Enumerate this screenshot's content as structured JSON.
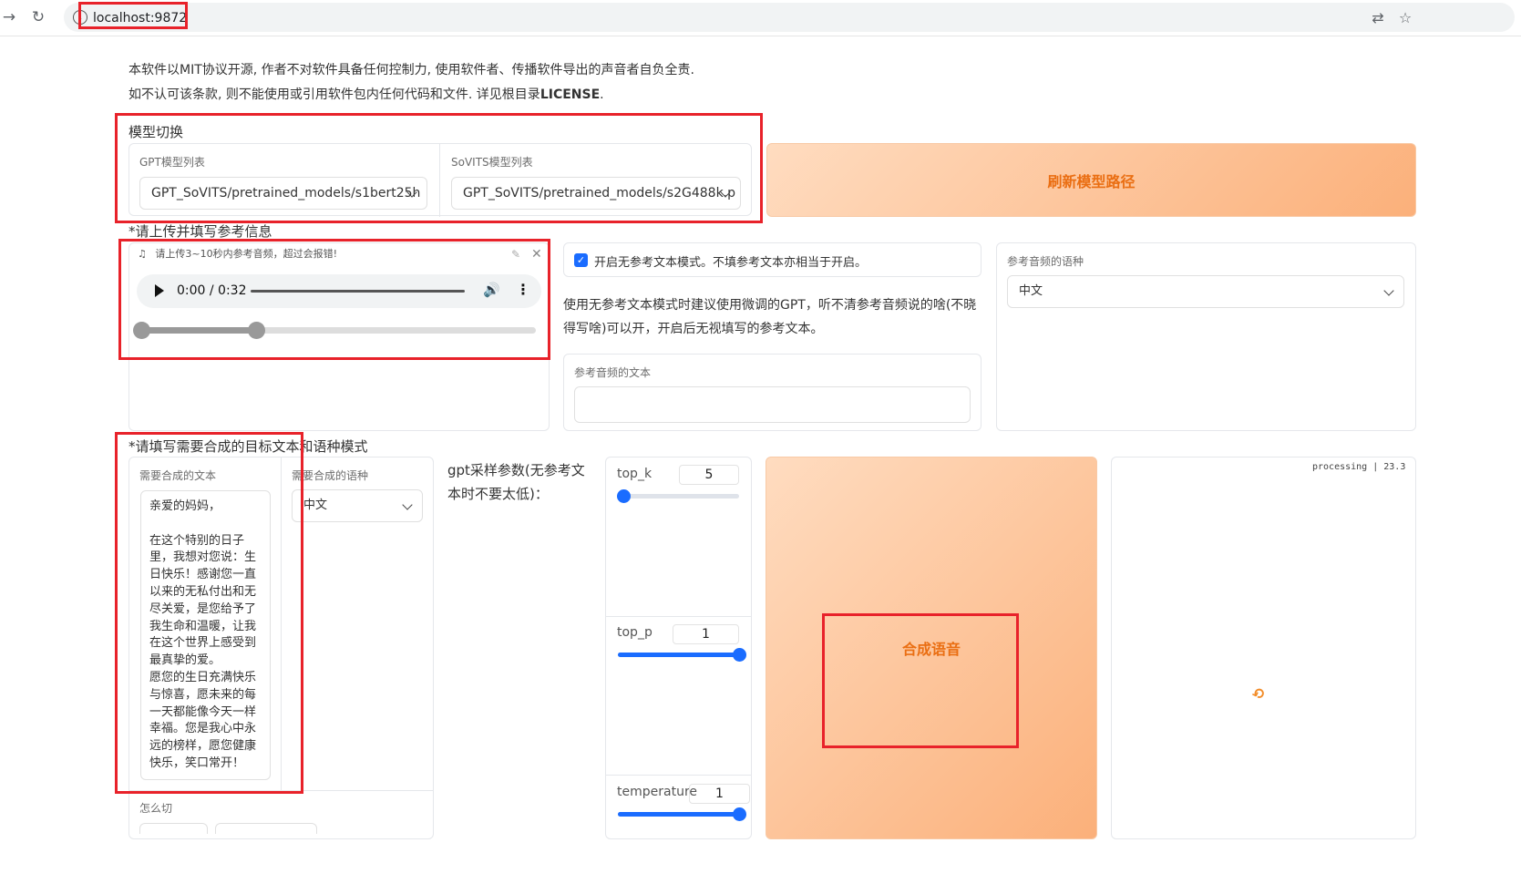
{
  "browser": {
    "url": "localhost:9872",
    "back_icon": "arrow-right-icon",
    "reload_icon": "reload-icon",
    "translate_icon": "translate-icon",
    "star_icon": "star-icon"
  },
  "notice": {
    "line1": "本软件以MIT协议开源, 作者不对软件具备任何控制力, 使用软件者、传播软件导出的声音者自负全责.",
    "line2_prefix": "如不认可该条款, 则不能使用或引用软件包内任何代码和文件. 详见根目录",
    "line2_bold": "LICENSE",
    "line2_suffix": "."
  },
  "model_switch": {
    "title": "模型切换",
    "gpt_label": "GPT模型列表",
    "gpt_value": "GPT_SoVITS/pretrained_models/s1bert25h",
    "sovits_label": "SoVITS模型列表",
    "sovits_value": "GPT_SoVITS/pretrained_models/s2G488k.p",
    "refresh_button": "刷新模型路径"
  },
  "reference": {
    "section_title": "*请上传并填写参考信息",
    "audio_hint": "请上传3~10秒内参考音频，超过会报错!",
    "audio_time": "0:00 / 0:32",
    "trim_start_fraction": 0,
    "trim_end_fraction": 0.3,
    "no_ref_checkbox_label": "开启无参考文本模式。不填参考文本亦相当于开启。",
    "no_ref_checked": true,
    "no_ref_hint": "使用无参考文本模式时建议使用微调的GPT，听不清参考音频说的啥(不晓得写啥)可以开，开启后无视填写的参考文本。",
    "ref_text_label": "参考音频的文本",
    "ref_text_value": "",
    "ref_lang_label": "参考音频的语种",
    "ref_lang_value": "中文"
  },
  "target": {
    "section_title": "*请填写需要合成的目标文本和语种模式",
    "text_label": "需要合成的文本",
    "text_value": "亲爱的妈妈，\n\n在这个特别的日子里，我想对您说：生日快乐！感谢您一直以来的无私付出和无尽关爱，是您给予了我生命和温暖，让我在这个世界上感受到最真挚的爱。\n愿您的生日充满快乐与惊喜，愿未来的每一天都能像今天一样幸福。您是我心中永远的榜样，愿您健康快乐，笑口常开！",
    "lang_label": "需要合成的语种",
    "lang_value": "中文",
    "cut_label": "怎么切"
  },
  "gpt_params": {
    "title": "gpt采样参数(无参考文本时不要太低)：",
    "top_k_label": "top_k",
    "top_k_value": "5",
    "top_k_fraction": 0.05,
    "top_p_label": "top_p",
    "top_p_value": "1",
    "top_p_fraction": 1.0,
    "temperature_label": "temperature",
    "temperature_value": "1",
    "temperature_fraction": 1.0
  },
  "synth": {
    "button": "合成语音",
    "status": "processing | 23.3",
    "loader_icon": "loading-spinner-icon"
  },
  "colors": {
    "accent_orange": "#ea6e12",
    "slider_blue": "#1a6cff",
    "highlight_red": "#e8222a"
  }
}
